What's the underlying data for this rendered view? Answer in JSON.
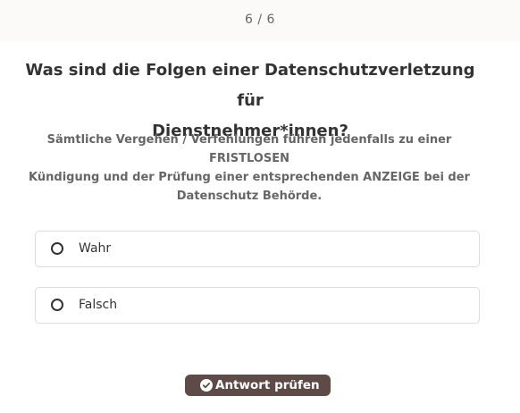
{
  "header": {
    "progress": "6 / 6"
  },
  "question": {
    "line1": "Was sind die Folgen einer Datenschutzverletzung für",
    "line2": "Dienstnehmer*innen?"
  },
  "explanation": {
    "line1": "Sämtliche Vergehen / Verfehlungen führen jedenfalls zu einer FRISTLOSEN",
    "line2": "Kündigung und der Prüfung einer entsprechenden ANZEIGE bei der",
    "line3": "Datenschutz Behörde."
  },
  "options": [
    {
      "label": "Wahr",
      "selected": false
    },
    {
      "label": "Falsch",
      "selected": false
    }
  ],
  "submit": {
    "label": "Antwort prüfen",
    "icon": "check-circle-icon"
  },
  "colors": {
    "button_bg": "#5e4b48",
    "text": "#333333",
    "muted": "#666666",
    "border": "#dcdcdc"
  }
}
